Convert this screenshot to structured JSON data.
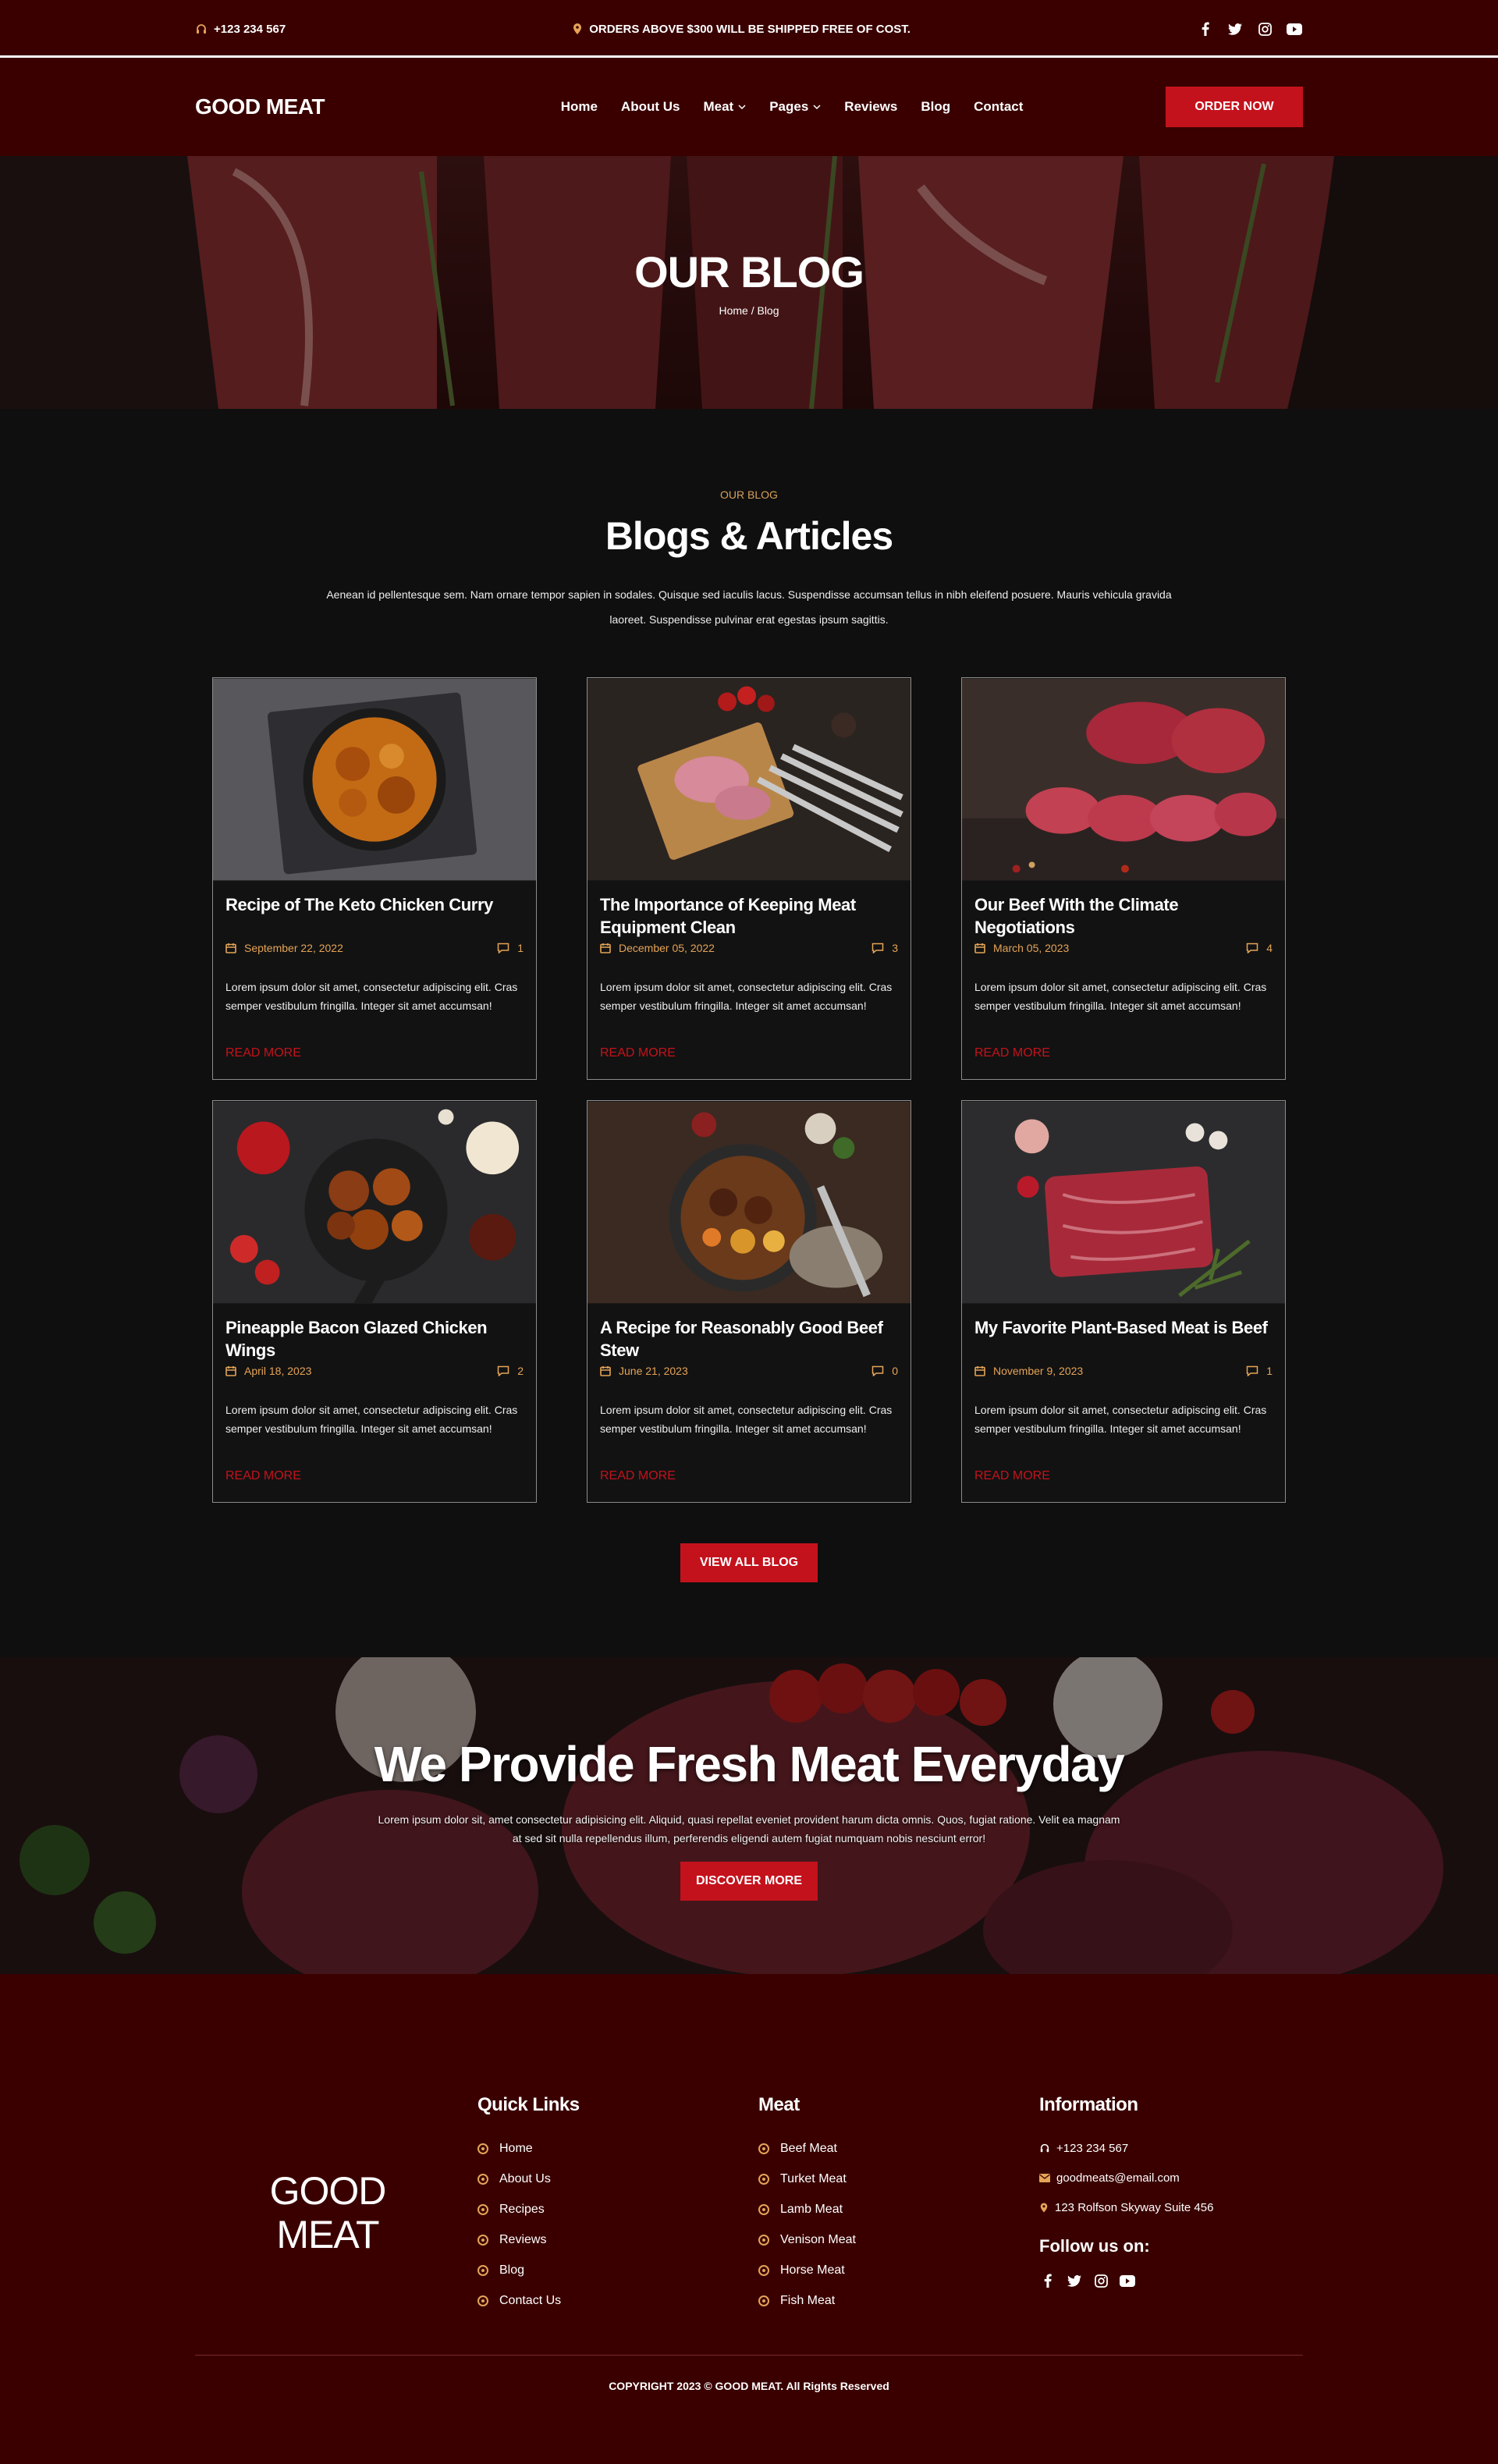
{
  "topbar": {
    "phone": "+123 234 567",
    "notice": "ORDERS ABOVE $300 WILL BE SHIPPED FREE OF COST.",
    "social": [
      "facebook-icon",
      "twitter-icon",
      "instagram-icon",
      "youtube-icon"
    ]
  },
  "nav": {
    "logo": "GOOD MEAT",
    "items": [
      "Home",
      "About Us",
      "Meat",
      "Pages",
      "Reviews",
      "Blog",
      "Contact"
    ],
    "order_label": "ORDER NOW"
  },
  "hero": {
    "title": "OUR BLOG",
    "breadcrumb": "Home / Blog"
  },
  "blog": {
    "eyebrow": "OUR BLOG",
    "title": "Blogs & Articles",
    "lead": "Aenean id pellentesque sem. Nam ornare tempor sapien in sodales. Quisque sed iaculis lacus. Suspendisse accumsan tellus in nibh eleifend posuere. Mauris vehicula gravida laoreet. Suspendisse pulvinar erat egestas ipsum sagittis.",
    "read_more": "READ MORE",
    "view_all": "VIEW ALL BLOG",
    "posts": [
      {
        "title": "Recipe of The Keto Chicken Curry",
        "date": "September 22, 2022",
        "comments": "1",
        "excerpt": "Lorem ipsum dolor sit amet, consectetur adipiscing elit. Cras semper vestibulum fringilla. Integer sit amet accumsan!"
      },
      {
        "title": "The Importance of Keeping Meat Equipment Clean",
        "date": "December 05, 2022",
        "comments": "3",
        "excerpt": "Lorem ipsum dolor sit amet, consectetur adipiscing elit. Cras semper vestibulum fringilla. Integer sit amet accumsan!"
      },
      {
        "title": "Our Beef With the Climate Negotiations",
        "date": "March 05, 2023",
        "comments": "4",
        "excerpt": "Lorem ipsum dolor sit amet, consectetur adipiscing elit. Cras semper vestibulum fringilla. Integer sit amet accumsan!"
      },
      {
        "title": "Pineapple Bacon Glazed Chicken Wings",
        "date": "April 18, 2023",
        "comments": "2",
        "excerpt": "Lorem ipsum dolor sit amet, consectetur adipiscing elit. Cras semper vestibulum fringilla. Integer sit amet accumsan!"
      },
      {
        "title": "A Recipe for Reasonably Good Beef Stew",
        "date": "June 21, 2023",
        "comments": "0",
        "excerpt": "Lorem ipsum dolor sit amet, consectetur adipiscing elit. Cras semper vestibulum fringilla. Integer sit amet accumsan!"
      },
      {
        "title": "My Favorite Plant-Based Meat is Beef",
        "date": "November 9, 2023",
        "comments": "1",
        "excerpt": "Lorem ipsum dolor sit amet, consectetur adipiscing elit. Cras semper vestibulum fringilla. Integer sit amet accumsan!"
      }
    ]
  },
  "cta": {
    "title": "We Provide Fresh Meat Everyday",
    "text": "Lorem ipsum dolor sit, amet consectetur adipisicing elit. Aliquid, quasi repellat eveniet provident harum dicta omnis. Quos, fugiat ratione. Velit ea magnam at sed sit nulla repellendus illum, perferendis eligendi autem fugiat numquam nobis nesciunt error!",
    "button": "DISCOVER MORE"
  },
  "footer": {
    "logo_line1": "GOOD",
    "logo_line2": "MEAT",
    "quick_links": {
      "title": "Quick Links",
      "items": [
        "Home",
        "About Us",
        "Recipes",
        "Reviews",
        "Blog",
        "Contact Us"
      ]
    },
    "meat": {
      "title": "Meat",
      "items": [
        "Beef Meat",
        "Turket Meat",
        "Lamb Meat",
        "Venison Meat",
        "Horse Meat",
        "Fish Meat"
      ]
    },
    "information": {
      "title": "Information",
      "phone": "+123 234 567",
      "email": "goodmeats@email.com",
      "address": "123 Rolfson Skyway Suite 456"
    },
    "follow": "Follow us on:",
    "copyright": "COPYRIGHT 2023 © GOOD MEAT. All Rights Reserved"
  },
  "colors": {
    "maroon": "#3a0000",
    "accent_red": "#c4121c",
    "gold": "#e5a457",
    "page_bg": "#0f0f0f"
  }
}
